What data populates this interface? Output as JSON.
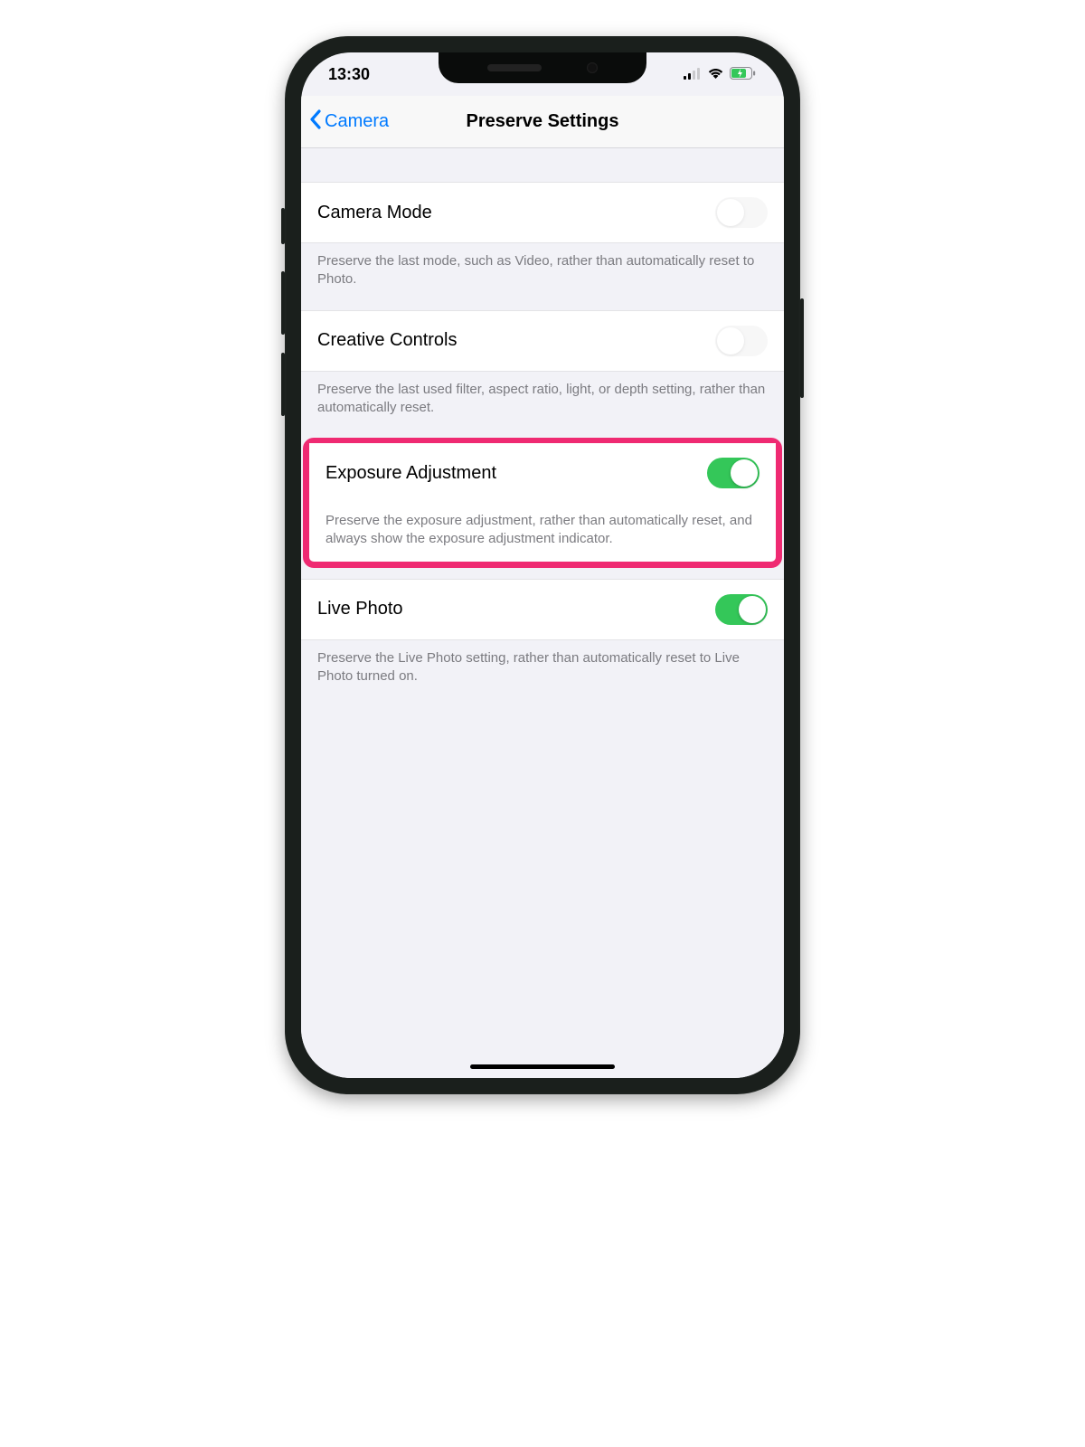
{
  "status": {
    "time": "13:30"
  },
  "nav": {
    "back_label": "Camera",
    "title": "Preserve Settings"
  },
  "settings": [
    {
      "title": "Camera Mode",
      "footer": "Preserve the last mode, such as Video, rather than automatically reset to Photo.",
      "enabled": false,
      "highlighted": false
    },
    {
      "title": "Creative Controls",
      "footer": "Preserve the last used filter, aspect ratio, light, or depth setting, rather than automatically reset.",
      "enabled": false,
      "highlighted": false
    },
    {
      "title": "Exposure Adjustment",
      "footer": "Preserve the exposure adjustment, rather than automatically reset, and always show the exposure adjustment indicator.",
      "enabled": true,
      "highlighted": true
    },
    {
      "title": "Live Photo",
      "footer": "Preserve the Live Photo setting, rather than automatically reset to Live Photo turned on.",
      "enabled": true,
      "highlighted": false
    }
  ],
  "colors": {
    "accent_blue": "#007aff",
    "toggle_green": "#34c759",
    "highlight_pink": "#ef2a72"
  }
}
